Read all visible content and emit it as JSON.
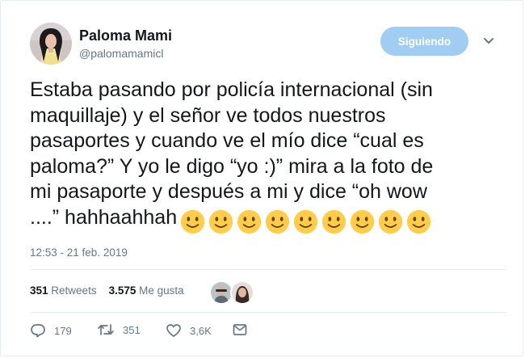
{
  "user": {
    "name": "Paloma Mami",
    "handle": "@palomamamicl",
    "avatar": "avatar-photo"
  },
  "follow_button": {
    "label": "Siguiendo",
    "color": "#a2cdf3"
  },
  "tweet": {
    "lines": [
      "Estaba pasando por policía internacional (sin",
      "maquillaje) y el señor ve todos nuestros",
      "pasaportes y cuando ve el mío dice “cual es",
      "paloma?” Y yo le digo “yo :)” mira a la foto de",
      "mi pasaporte y después a mi y dice “oh wow",
      "....” hahhaahhah"
    ],
    "emoji": "slightly-smiling-face",
    "emoji_count": 9
  },
  "timestamp": "12:53 - 21 feb. 2019",
  "stats": {
    "retweets_count": "351",
    "retweets_label": "Retweets",
    "likes_count": "3.575",
    "likes_label": "Me gusta"
  },
  "actions": {
    "replies": "179",
    "retweets": "351",
    "likes": "3,6K"
  },
  "colors": {
    "text": "#14171a",
    "secondary": "#657786",
    "border": "#e6ecf0",
    "emoji_yellow": "#ffcc4d"
  }
}
